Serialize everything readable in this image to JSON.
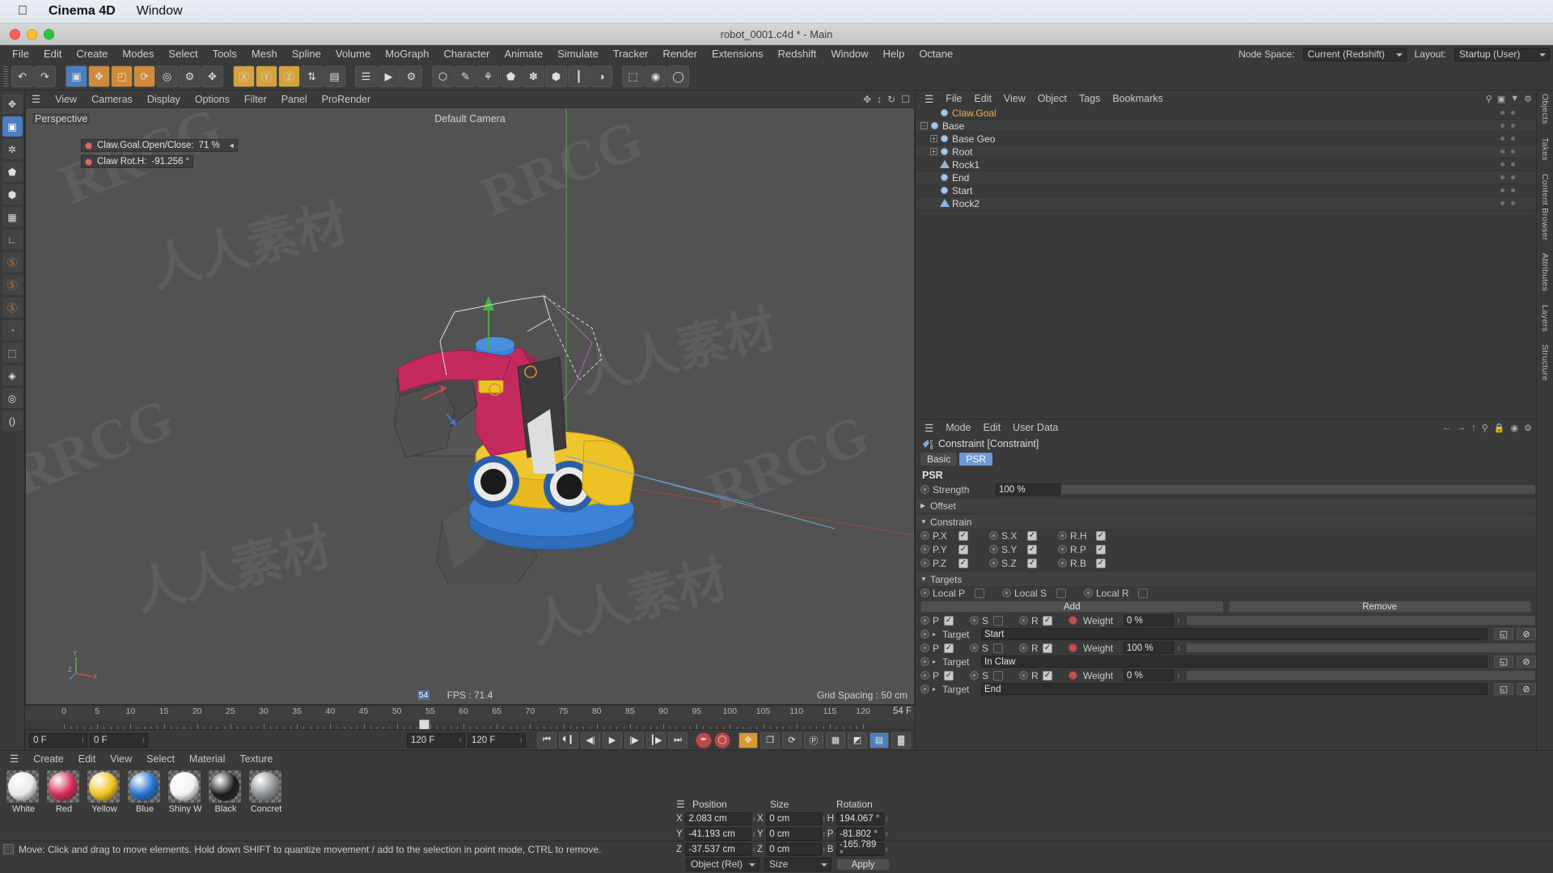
{
  "os_menu": {
    "apple_icon": "apple-icon",
    "app_name": "Cinema 4D",
    "window_menu": "Window"
  },
  "window": {
    "title": "robot_0001.c4d * - Main"
  },
  "main_menu": [
    "File",
    "Edit",
    "Create",
    "Modes",
    "Select",
    "Tools",
    "Mesh",
    "Spline",
    "Volume",
    "MoGraph",
    "Character",
    "Animate",
    "Simulate",
    "Tracker",
    "Render",
    "Extensions",
    "Redshift",
    "Window",
    "Help",
    "Octane"
  ],
  "menu_right": {
    "node_space_label": "Node Space:",
    "node_space_value": "Current (Redshift)",
    "layout_label": "Layout:",
    "layout_value": "Startup (User)"
  },
  "viewport_menu": [
    "View",
    "Cameras",
    "Display",
    "Options",
    "Filter",
    "Panel",
    "ProRender"
  ],
  "viewport": {
    "projection": "Perspective",
    "camera": "Default Camera",
    "hud": [
      {
        "label": "Claw.Goal.Open/Close:",
        "value": "71 %"
      },
      {
        "label": "Claw Rot.H:",
        "value": "-91.256 °"
      }
    ],
    "fps": "FPS : 71.4",
    "grid_spacing": "Grid Spacing : 50 cm",
    "axis_labels": {
      "x": "X",
      "y": "Y",
      "z": "Z"
    }
  },
  "timeline": {
    "ticks": [
      "0",
      "5",
      "10",
      "15",
      "20",
      "25",
      "30",
      "35",
      "40",
      "45",
      "50",
      "55",
      "60",
      "65",
      "70",
      "75",
      "80",
      "85",
      "90",
      "95",
      "100",
      "105",
      "110",
      "115",
      "120"
    ],
    "current_frame_marker": "54",
    "current_frame_field": "54 F",
    "start_field": "0 F",
    "end_field": "0 F",
    "range_start": "120 F",
    "range_end": "120 F"
  },
  "transport": {
    "buttons": [
      "goto-start",
      "prev-key",
      "prev-frame",
      "play",
      "next-frame",
      "next-key",
      "goto-end",
      "record",
      "autokey"
    ],
    "mode_icons": [
      "key-position",
      "key-scale",
      "key-rotation",
      "key-param",
      "key-point"
    ]
  },
  "material_manager": {
    "menu": [
      "Create",
      "Edit",
      "View",
      "Select",
      "Material",
      "Texture"
    ],
    "materials": [
      {
        "name": "White",
        "color": "#e8e8e8"
      },
      {
        "name": "Red",
        "color": "#d32a52"
      },
      {
        "name": "Yellow",
        "color": "#f0c21c"
      },
      {
        "name": "Blue",
        "color": "#1f6fd0"
      },
      {
        "name": "Shiny W",
        "color": "#f2f2f2"
      },
      {
        "name": "Black",
        "color": "#1c1c1c"
      },
      {
        "name": "Concret",
        "color": "#8d9094"
      }
    ]
  },
  "coordinates": {
    "headers": {
      "position": "Position",
      "size": "Size",
      "rotation": "Rotation"
    },
    "position": {
      "x": "2.083 cm",
      "y": "-41.193 cm",
      "z": "-37.537 cm"
    },
    "size": {
      "x": "0 cm",
      "y": "0 cm",
      "z": "0 cm"
    },
    "rotation": {
      "h": "194.067 °",
      "p": "-81.802 °",
      "b": "-165.789 °"
    },
    "axis_labels": {
      "px": "X",
      "py": "Y",
      "pz": "Z",
      "sx": "X",
      "sy": "Y",
      "sz": "Z",
      "rh": "H",
      "rp": "P",
      "rb": "B"
    },
    "mode_select": "Object (Rel)",
    "size_select": "Size",
    "apply_button": "Apply"
  },
  "object_manager": {
    "menu": [
      "File",
      "Edit",
      "View",
      "Object",
      "Tags",
      "Bookmarks"
    ],
    "items": [
      {
        "name": "Claw.Goal",
        "icon": "null-object-icon",
        "indent": 1,
        "selected": true,
        "expander": "",
        "tags": []
      },
      {
        "name": "Base",
        "icon": "null-object-icon",
        "indent": 0,
        "selected": false,
        "expander": "-",
        "tags": []
      },
      {
        "name": "Base Geo",
        "icon": "null-object-icon",
        "indent": 1,
        "selected": false,
        "expander": "+",
        "tags": []
      },
      {
        "name": "Root",
        "icon": "null-object-icon",
        "indent": 1,
        "selected": false,
        "expander": "+",
        "tags": []
      },
      {
        "name": "Rock1",
        "icon": "polygon-object-icon",
        "indent": 1,
        "selected": false,
        "expander": "",
        "tags": [
          "#d8623c",
          "#4e9ad8",
          "#cfcfcf",
          "#9b9b9b"
        ]
      },
      {
        "name": "End",
        "icon": "null-object-icon",
        "indent": 1,
        "selected": false,
        "expander": "",
        "tags": []
      },
      {
        "name": "Start",
        "icon": "null-object-icon",
        "indent": 1,
        "selected": false,
        "expander": "",
        "tags": []
      },
      {
        "name": "Rock2",
        "icon": "polygon-object-icon",
        "indent": 1,
        "selected": false,
        "expander": "",
        "tags": [
          "#d8623c",
          "#cfcfcf",
          "#9b9b9b"
        ]
      }
    ]
  },
  "attribute_manager": {
    "menu": [
      "Mode",
      "Edit",
      "User Data"
    ],
    "object_title": "Constraint [Constraint]",
    "tabs": [
      {
        "label": "Basic",
        "active": false
      },
      {
        "label": "PSR",
        "active": true
      }
    ],
    "section_psr": "PSR",
    "strength_label": "Strength",
    "strength_value": "100 %",
    "offset_label": "Offset",
    "constrain_label": "Constrain",
    "constrain_rows": [
      {
        "p": "P.X",
        "p_on": true,
        "s": "S.X",
        "s_on": true,
        "r": "R.H",
        "r_on": true
      },
      {
        "p": "P.Y",
        "p_on": true,
        "s": "S.Y",
        "s_on": true,
        "r": "R.P",
        "r_on": true
      },
      {
        "p": "P.Z",
        "p_on": true,
        "s": "S.Z",
        "s_on": true,
        "r": "R.B",
        "r_on": true
      }
    ],
    "targets_label": "Targets",
    "local_row": [
      {
        "label": "Local P",
        "on": false
      },
      {
        "label": "Local S",
        "on": false
      },
      {
        "label": "Local R",
        "on": false
      }
    ],
    "add_button": "Add",
    "remove_button": "Remove",
    "targets": [
      {
        "p_label": "P",
        "p_on": true,
        "s_label": "S",
        "s_on": false,
        "r_label": "R",
        "r_on": true,
        "weight_label": "Weight",
        "weight_value": "0 %",
        "target_label": "Target",
        "target_value": "Start"
      },
      {
        "p_label": "P",
        "p_on": true,
        "s_label": "S",
        "s_on": false,
        "r_label": "R",
        "r_on": true,
        "weight_label": "Weight",
        "weight_value": "100 %",
        "target_label": "Target",
        "target_value": "In Claw"
      },
      {
        "p_label": "P",
        "p_on": true,
        "s_label": "S",
        "s_on": false,
        "r_label": "R",
        "r_on": true,
        "weight_label": "Weight",
        "weight_value": "0 %",
        "target_label": "Target",
        "target_value": "End"
      }
    ]
  },
  "right_dock": [
    "Objects",
    "Takes",
    "Content Browser",
    "Attributes",
    "Layers",
    "Structure"
  ],
  "status_bar": {
    "message": "Move: Click and drag to move elements. Hold down SHIFT to quantize movement / add to the selection in point mode, CTRL to remove."
  },
  "colors": {
    "accent_blue": "#6e9ad4",
    "selected_text": "#e8b44a",
    "panel_bg": "#3a3a3a",
    "viewport_bg": "#525252"
  },
  "watermarks": {
    "rrcg": "RRCG",
    "cn": "人人素材"
  }
}
